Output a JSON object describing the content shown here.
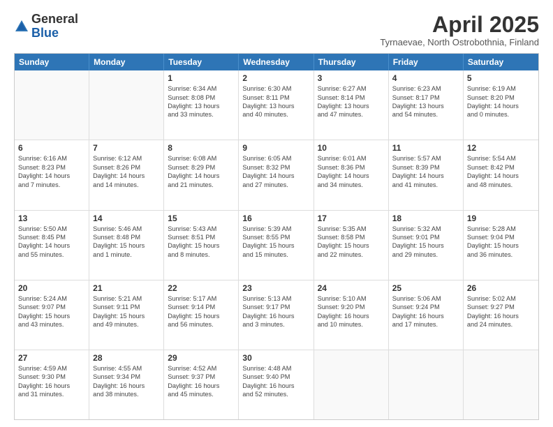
{
  "logo": {
    "general": "General",
    "blue": "Blue"
  },
  "title": "April 2025",
  "subtitle": "Tyrnaevae, North Ostrobothnia, Finland",
  "header_days": [
    "Sunday",
    "Monday",
    "Tuesday",
    "Wednesday",
    "Thursday",
    "Friday",
    "Saturday"
  ],
  "weeks": [
    [
      {
        "day": "",
        "lines": []
      },
      {
        "day": "",
        "lines": []
      },
      {
        "day": "1",
        "lines": [
          "Sunrise: 6:34 AM",
          "Sunset: 8:08 PM",
          "Daylight: 13 hours",
          "and 33 minutes."
        ]
      },
      {
        "day": "2",
        "lines": [
          "Sunrise: 6:30 AM",
          "Sunset: 8:11 PM",
          "Daylight: 13 hours",
          "and 40 minutes."
        ]
      },
      {
        "day": "3",
        "lines": [
          "Sunrise: 6:27 AM",
          "Sunset: 8:14 PM",
          "Daylight: 13 hours",
          "and 47 minutes."
        ]
      },
      {
        "day": "4",
        "lines": [
          "Sunrise: 6:23 AM",
          "Sunset: 8:17 PM",
          "Daylight: 13 hours",
          "and 54 minutes."
        ]
      },
      {
        "day": "5",
        "lines": [
          "Sunrise: 6:19 AM",
          "Sunset: 8:20 PM",
          "Daylight: 14 hours",
          "and 0 minutes."
        ]
      }
    ],
    [
      {
        "day": "6",
        "lines": [
          "Sunrise: 6:16 AM",
          "Sunset: 8:23 PM",
          "Daylight: 14 hours",
          "and 7 minutes."
        ]
      },
      {
        "day": "7",
        "lines": [
          "Sunrise: 6:12 AM",
          "Sunset: 8:26 PM",
          "Daylight: 14 hours",
          "and 14 minutes."
        ]
      },
      {
        "day": "8",
        "lines": [
          "Sunrise: 6:08 AM",
          "Sunset: 8:29 PM",
          "Daylight: 14 hours",
          "and 21 minutes."
        ]
      },
      {
        "day": "9",
        "lines": [
          "Sunrise: 6:05 AM",
          "Sunset: 8:32 PM",
          "Daylight: 14 hours",
          "and 27 minutes."
        ]
      },
      {
        "day": "10",
        "lines": [
          "Sunrise: 6:01 AM",
          "Sunset: 8:36 PM",
          "Daylight: 14 hours",
          "and 34 minutes."
        ]
      },
      {
        "day": "11",
        "lines": [
          "Sunrise: 5:57 AM",
          "Sunset: 8:39 PM",
          "Daylight: 14 hours",
          "and 41 minutes."
        ]
      },
      {
        "day": "12",
        "lines": [
          "Sunrise: 5:54 AM",
          "Sunset: 8:42 PM",
          "Daylight: 14 hours",
          "and 48 minutes."
        ]
      }
    ],
    [
      {
        "day": "13",
        "lines": [
          "Sunrise: 5:50 AM",
          "Sunset: 8:45 PM",
          "Daylight: 14 hours",
          "and 55 minutes."
        ]
      },
      {
        "day": "14",
        "lines": [
          "Sunrise: 5:46 AM",
          "Sunset: 8:48 PM",
          "Daylight: 15 hours",
          "and 1 minute."
        ]
      },
      {
        "day": "15",
        "lines": [
          "Sunrise: 5:43 AM",
          "Sunset: 8:51 PM",
          "Daylight: 15 hours",
          "and 8 minutes."
        ]
      },
      {
        "day": "16",
        "lines": [
          "Sunrise: 5:39 AM",
          "Sunset: 8:55 PM",
          "Daylight: 15 hours",
          "and 15 minutes."
        ]
      },
      {
        "day": "17",
        "lines": [
          "Sunrise: 5:35 AM",
          "Sunset: 8:58 PM",
          "Daylight: 15 hours",
          "and 22 minutes."
        ]
      },
      {
        "day": "18",
        "lines": [
          "Sunrise: 5:32 AM",
          "Sunset: 9:01 PM",
          "Daylight: 15 hours",
          "and 29 minutes."
        ]
      },
      {
        "day": "19",
        "lines": [
          "Sunrise: 5:28 AM",
          "Sunset: 9:04 PM",
          "Daylight: 15 hours",
          "and 36 minutes."
        ]
      }
    ],
    [
      {
        "day": "20",
        "lines": [
          "Sunrise: 5:24 AM",
          "Sunset: 9:07 PM",
          "Daylight: 15 hours",
          "and 43 minutes."
        ]
      },
      {
        "day": "21",
        "lines": [
          "Sunrise: 5:21 AM",
          "Sunset: 9:11 PM",
          "Daylight: 15 hours",
          "and 49 minutes."
        ]
      },
      {
        "day": "22",
        "lines": [
          "Sunrise: 5:17 AM",
          "Sunset: 9:14 PM",
          "Daylight: 15 hours",
          "and 56 minutes."
        ]
      },
      {
        "day": "23",
        "lines": [
          "Sunrise: 5:13 AM",
          "Sunset: 9:17 PM",
          "Daylight: 16 hours",
          "and 3 minutes."
        ]
      },
      {
        "day": "24",
        "lines": [
          "Sunrise: 5:10 AM",
          "Sunset: 9:20 PM",
          "Daylight: 16 hours",
          "and 10 minutes."
        ]
      },
      {
        "day": "25",
        "lines": [
          "Sunrise: 5:06 AM",
          "Sunset: 9:24 PM",
          "Daylight: 16 hours",
          "and 17 minutes."
        ]
      },
      {
        "day": "26",
        "lines": [
          "Sunrise: 5:02 AM",
          "Sunset: 9:27 PM",
          "Daylight: 16 hours",
          "and 24 minutes."
        ]
      }
    ],
    [
      {
        "day": "27",
        "lines": [
          "Sunrise: 4:59 AM",
          "Sunset: 9:30 PM",
          "Daylight: 16 hours",
          "and 31 minutes."
        ]
      },
      {
        "day": "28",
        "lines": [
          "Sunrise: 4:55 AM",
          "Sunset: 9:34 PM",
          "Daylight: 16 hours",
          "and 38 minutes."
        ]
      },
      {
        "day": "29",
        "lines": [
          "Sunrise: 4:52 AM",
          "Sunset: 9:37 PM",
          "Daylight: 16 hours",
          "and 45 minutes."
        ]
      },
      {
        "day": "30",
        "lines": [
          "Sunrise: 4:48 AM",
          "Sunset: 9:40 PM",
          "Daylight: 16 hours",
          "and 52 minutes."
        ]
      },
      {
        "day": "",
        "lines": []
      },
      {
        "day": "",
        "lines": []
      },
      {
        "day": "",
        "lines": []
      }
    ]
  ]
}
